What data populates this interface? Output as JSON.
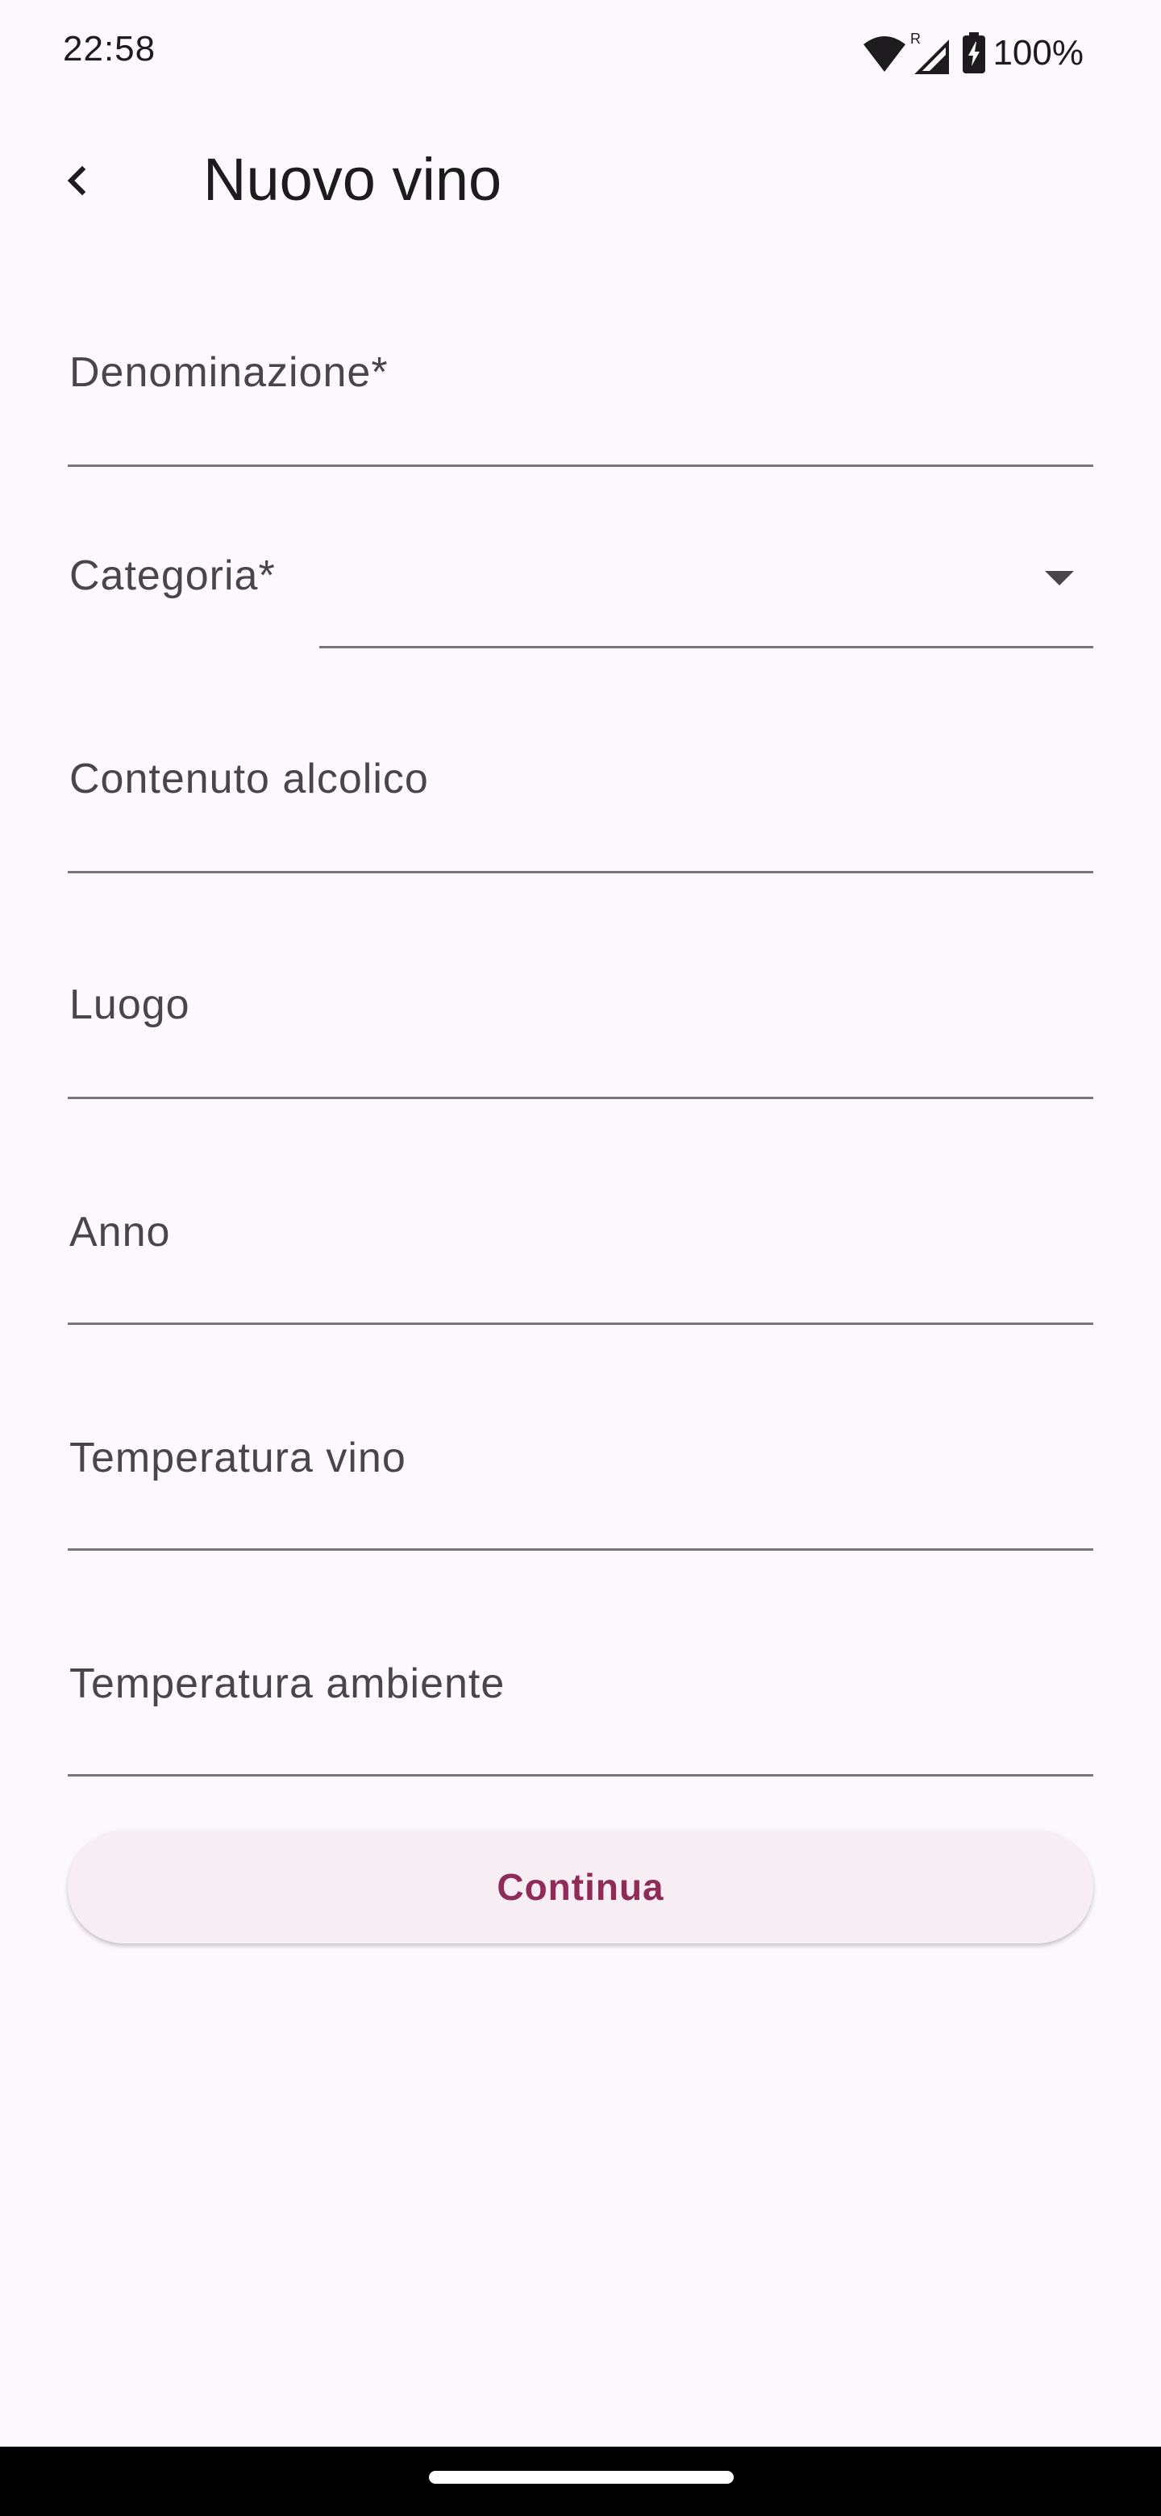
{
  "status_bar": {
    "time": "22:58",
    "battery": "100%",
    "icons": [
      "wifi-icon",
      "roaming-signal-icon",
      "battery-charging-icon"
    ]
  },
  "app_bar": {
    "back_icon": "back-arrow-icon",
    "title": "Nuovo vino"
  },
  "form": {
    "fields": [
      {
        "label": "Denominazione*",
        "value": ""
      },
      {
        "label": "Categoria*",
        "value": "",
        "type": "dropdown",
        "icon": "dropdown-arrow-icon"
      },
      {
        "label": "Contenuto alcolico",
        "value": ""
      },
      {
        "label": "Luogo",
        "value": ""
      },
      {
        "label": "Anno",
        "value": ""
      },
      {
        "label": "Temperatura vino",
        "value": ""
      },
      {
        "label": "Temperatura ambiente",
        "value": ""
      }
    ],
    "submit_label": "Continua"
  },
  "colors": {
    "background": "#fdf8fb",
    "accent": "#8e2b57",
    "button_surface": "#f7eef3",
    "underline": "#79747a",
    "label": "#4a454a"
  }
}
